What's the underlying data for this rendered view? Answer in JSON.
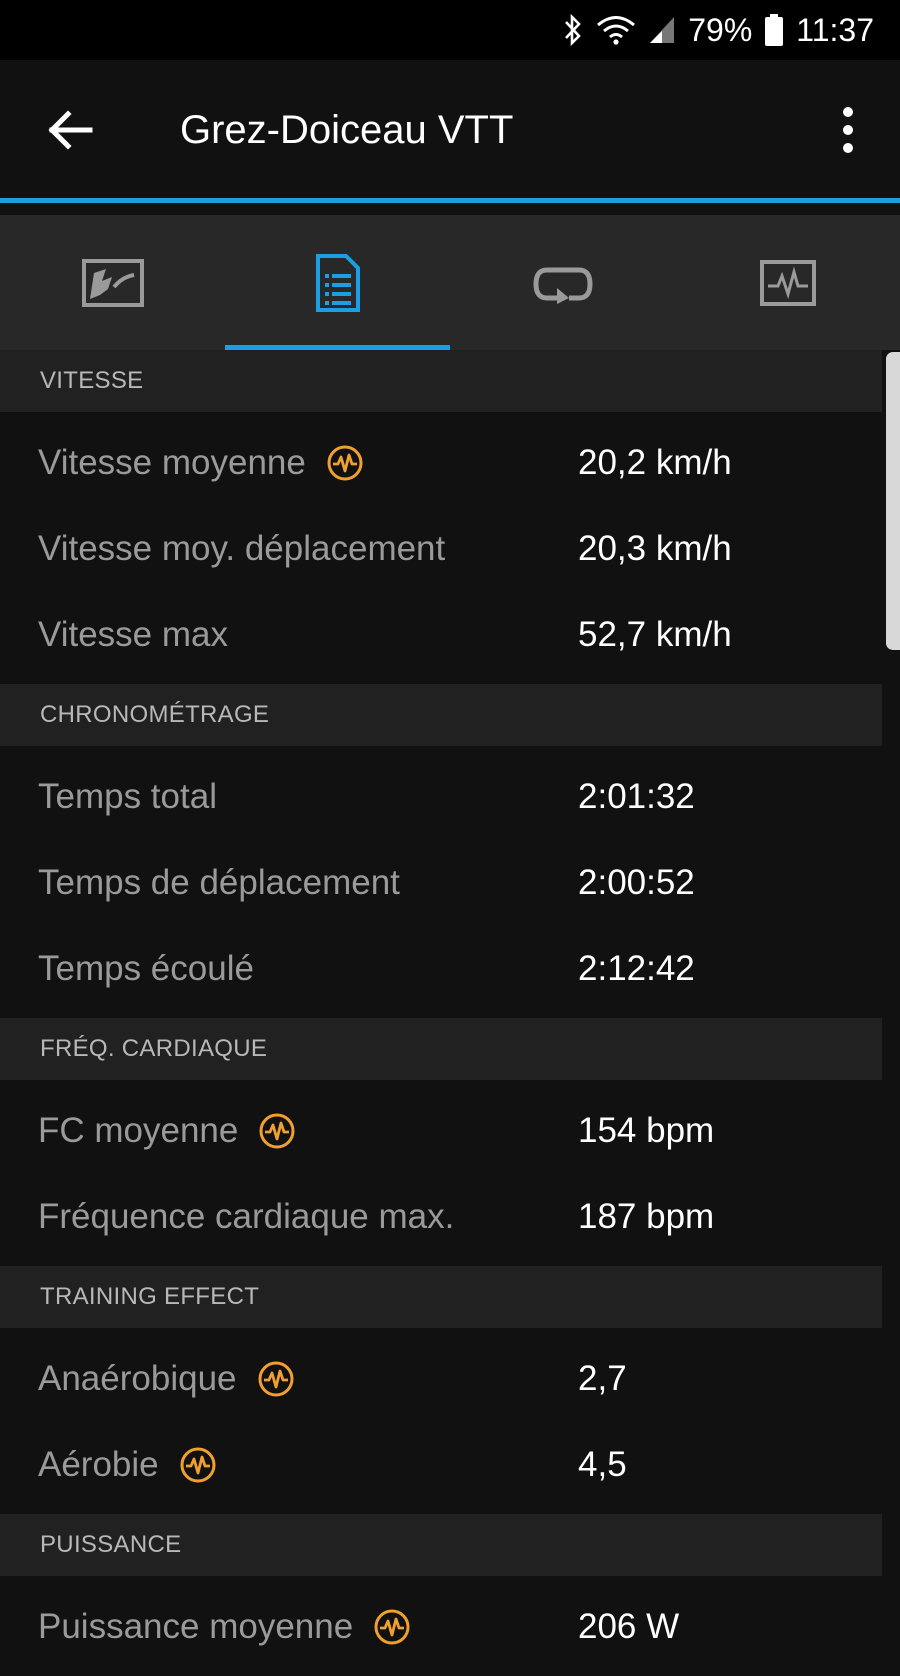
{
  "status_bar": {
    "battery": "79%",
    "time": "11:37"
  },
  "app_bar": {
    "title": "Grez-Doiceau VTT",
    "back_icon": "arrow-left-icon",
    "menu_icon": "more-vert-icon"
  },
  "tabs": [
    {
      "icon": "map-icon",
      "active": false
    },
    {
      "icon": "document-list-icon",
      "active": true
    },
    {
      "icon": "laps-icon",
      "active": false
    },
    {
      "icon": "chart-icon",
      "active": false
    }
  ],
  "colors": {
    "accent": "#1a9ee4",
    "badge": "#f0a030"
  },
  "sections": [
    {
      "header": "VITESSE",
      "rows": [
        {
          "label": "Vitesse moyenne",
          "value": "20,2 km/h",
          "badge": true
        },
        {
          "label": "Vitesse moy. déplacement",
          "value": "20,3 km/h",
          "badge": false
        },
        {
          "label": "Vitesse max",
          "value": "52,7 km/h",
          "badge": false
        }
      ]
    },
    {
      "header": "CHRONOMÉTRAGE",
      "rows": [
        {
          "label": "Temps total",
          "value": "2:01:32",
          "badge": false
        },
        {
          "label": "Temps de déplacement",
          "value": "2:00:52",
          "badge": false
        },
        {
          "label": "Temps écoulé",
          "value": "2:12:42",
          "badge": false
        }
      ]
    },
    {
      "header": "FRÉQ. CARDIAQUE",
      "rows": [
        {
          "label": "FC moyenne",
          "value": "154 bpm",
          "badge": true
        },
        {
          "label": "Fréquence cardiaque max.",
          "value": "187 bpm",
          "badge": false
        }
      ]
    },
    {
      "header": "TRAINING EFFECT",
      "rows": [
        {
          "label": "Anaérobique",
          "value": "2,7",
          "badge": true
        },
        {
          "label": "Aérobie",
          "value": "4,5",
          "badge": true
        }
      ]
    },
    {
      "header": "PUISSANCE",
      "rows": [
        {
          "label": "Puissance moyenne",
          "value": "206 W",
          "badge": true
        }
      ]
    }
  ]
}
